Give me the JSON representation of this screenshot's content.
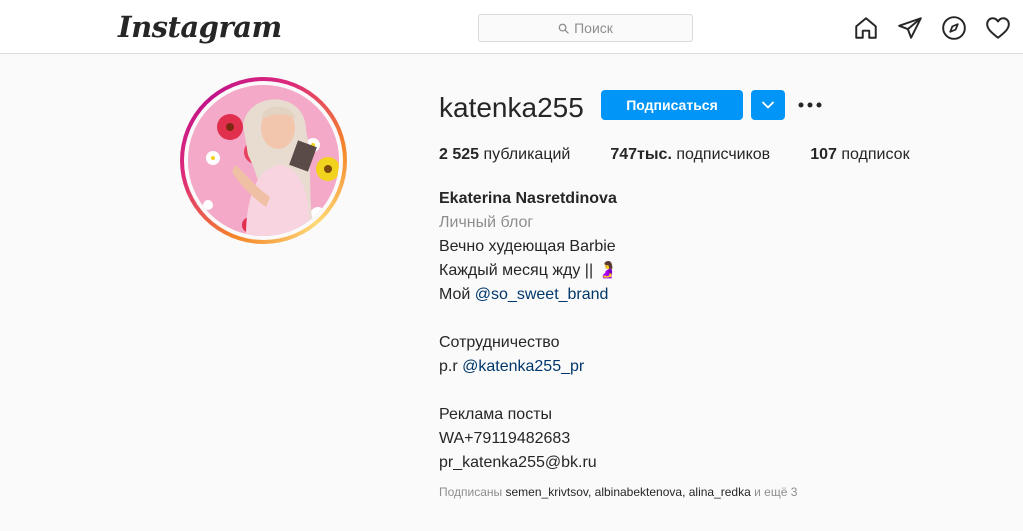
{
  "nav": {
    "logo": "Instagram",
    "search": {
      "placeholder": "Поиск"
    },
    "icons": [
      "home-icon",
      "direct-icon",
      "explore-icon",
      "activity-icon"
    ]
  },
  "profile": {
    "username": "katenka255",
    "follow_label": "Подписаться",
    "stats": {
      "posts_count": "2 525",
      "posts_label": "публикаций",
      "followers_count": "747тыс.",
      "followers_label": "подписчиков",
      "following_count": "107",
      "following_label": "подписок"
    },
    "bio": {
      "full_name": "Ekaterina Nasretdinova",
      "category": "Личный блог",
      "line1": "Вечно худеющая Barbie",
      "line2": "Каждый месяц жду || 🤰",
      "line3_prefix": "Мой ",
      "line3_link": "@so_sweet_brand",
      "line4": "Сотрудничество",
      "line5_prefix": "p.r ",
      "line5_link": "@katenka255_pr",
      "line6": "Реклама посты",
      "line7": "WA+79119482683",
      "line8": "pr_katenka255@bk.ru"
    },
    "followed_by": {
      "prefix": "Подписаны ",
      "user1": "semen_krivtsov",
      "sep1": ", ",
      "user2": "albinabektenova",
      "sep2": ", ",
      "user3": "alina_redka",
      "suffix": " и ещё 3"
    }
  },
  "colors": {
    "accent": "#0095f6",
    "link": "#00376b",
    "muted": "#8e8e8e",
    "text": "#262626",
    "background": "#fafafa"
  }
}
